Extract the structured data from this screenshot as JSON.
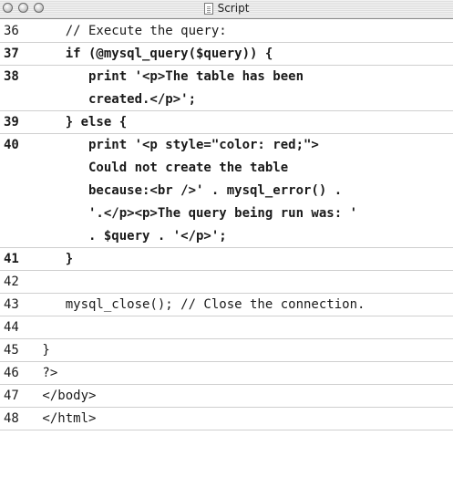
{
  "window": {
    "title": "Script"
  },
  "lines": [
    {
      "num": "36",
      "bold": false,
      "text": [
        "    // Execute the query:"
      ]
    },
    {
      "num": "37",
      "bold": true,
      "text": [
        "    if (@mysql_query($query)) {"
      ]
    },
    {
      "num": "38",
      "bold": true,
      "text": [
        "       print '<p>The table has been",
        "       created.</p>';"
      ]
    },
    {
      "num": "39",
      "bold": true,
      "text": [
        "    } else {"
      ]
    },
    {
      "num": "40",
      "bold": true,
      "text": [
        "       print '<p style=\"color: red;\">",
        "       Could not create the table",
        "       because:<br />' . mysql_error() .",
        "       '.</p><p>The query being run was: '",
        "       . $query . '</p>';"
      ]
    },
    {
      "num": "41",
      "bold": true,
      "text": [
        "    }"
      ]
    },
    {
      "num": "42",
      "bold": false,
      "text": [
        ""
      ]
    },
    {
      "num": "43",
      "bold": false,
      "text": [
        "    mysql_close(); // Close the connection."
      ]
    },
    {
      "num": "44",
      "bold": false,
      "text": [
        ""
      ]
    },
    {
      "num": "45",
      "bold": false,
      "text": [
        " }"
      ]
    },
    {
      "num": "46",
      "bold": false,
      "text": [
        " ?>"
      ]
    },
    {
      "num": "47",
      "bold": false,
      "text": [
        " </body>"
      ]
    },
    {
      "num": "48",
      "bold": false,
      "text": [
        " </html>"
      ]
    }
  ]
}
